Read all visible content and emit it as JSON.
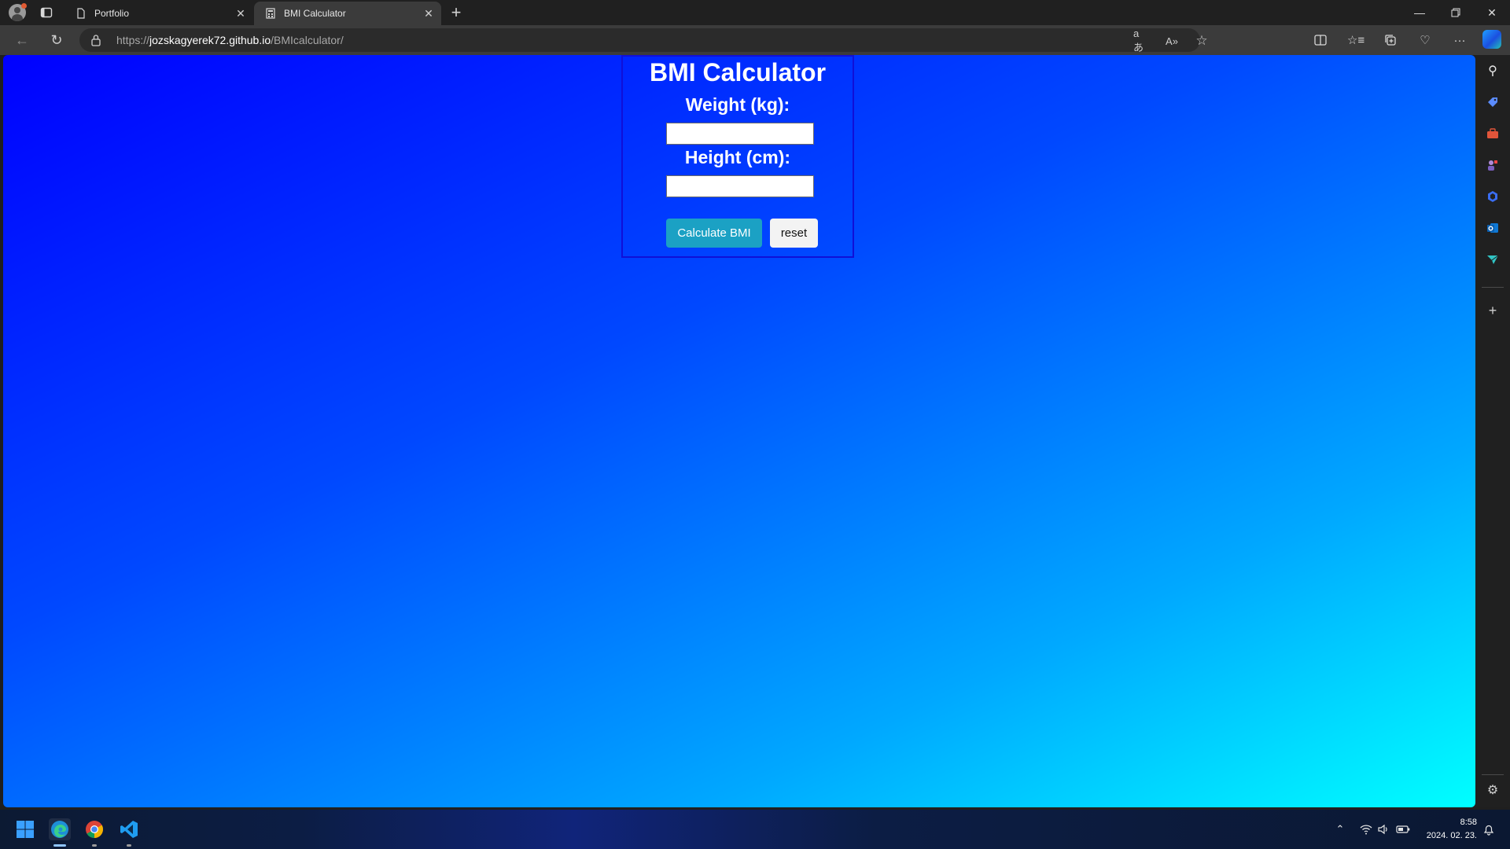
{
  "browser": {
    "tabs": [
      {
        "title": "Portfolio",
        "active": false
      },
      {
        "title": "BMI Calculator",
        "active": true
      }
    ],
    "address": {
      "scheme": "https://",
      "host": "jozskagyerek72.github.io",
      "path": "/BMIcalculator/"
    }
  },
  "page": {
    "title": "BMI Calculator",
    "weight_label": "Weight (kg):",
    "weight_value": "",
    "height_label": "Height (cm):",
    "height_value": "",
    "calculate_label": "Calculate BMI",
    "reset_label": "reset"
  },
  "taskbar": {
    "time": "8:58",
    "date": "2024. 02. 23."
  },
  "colors": {
    "background_start": "#0000ff",
    "background_end": "#00ffff",
    "calculate_button": "#1ba1c4"
  }
}
